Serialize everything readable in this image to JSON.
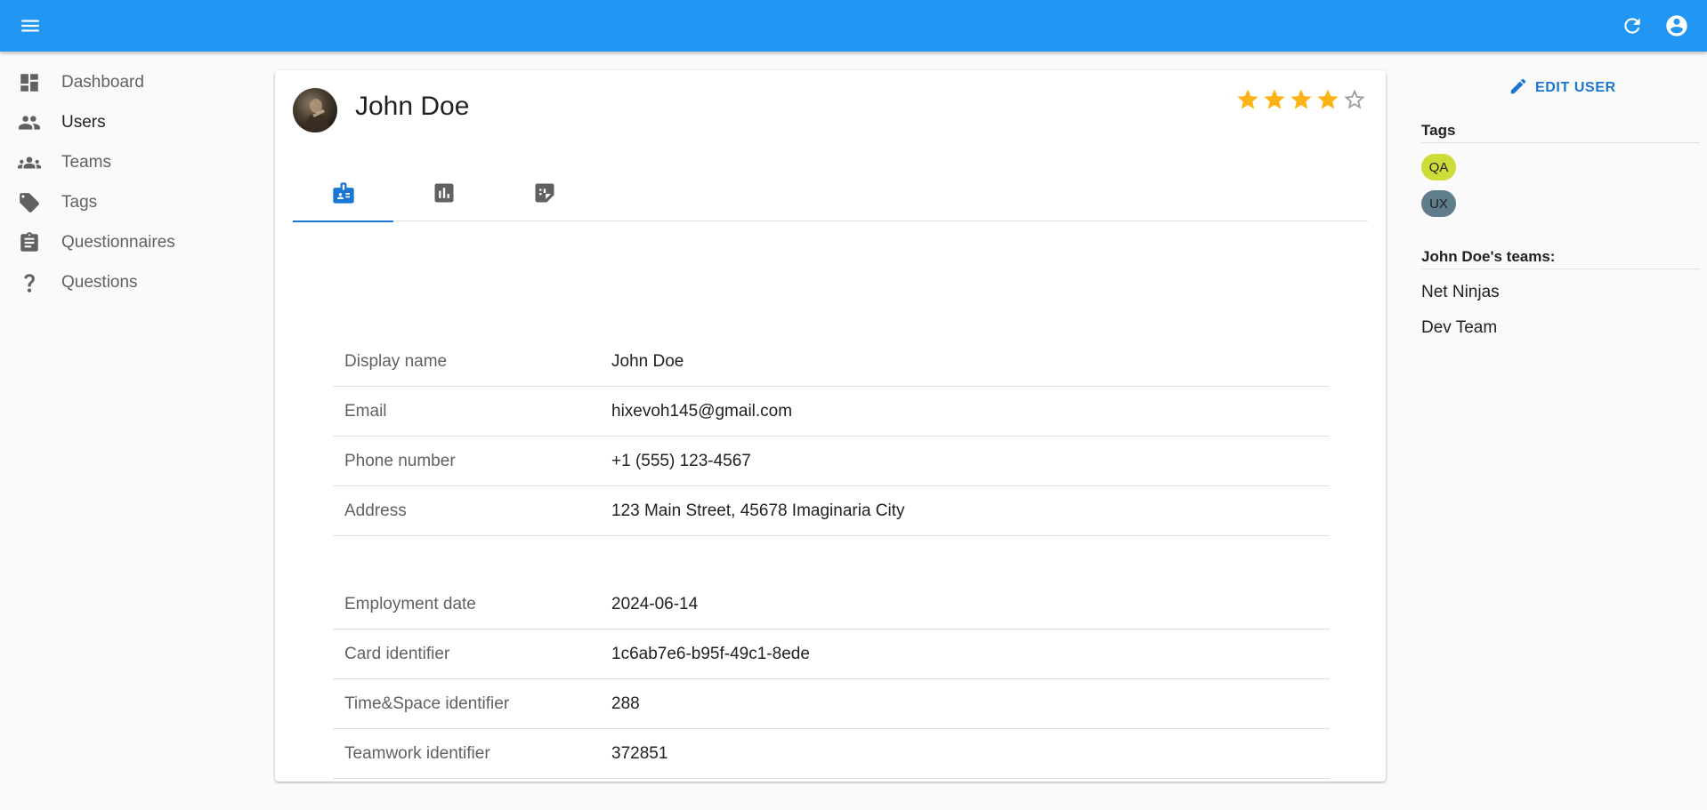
{
  "appbar": {
    "menu_icon": "menu-icon",
    "refresh_icon": "refresh-icon",
    "account_icon": "account-circle-icon",
    "color": "#2196f3"
  },
  "sidebar": {
    "items": [
      {
        "label": "Dashboard",
        "icon": "dashboard-icon"
      },
      {
        "label": "Users",
        "icon": "users-icon"
      },
      {
        "label": "Teams",
        "icon": "teams-icon"
      },
      {
        "label": "Tags",
        "icon": "tag-icon"
      },
      {
        "label": "Questionnaires",
        "icon": "clipboard-icon"
      },
      {
        "label": "Questions",
        "icon": "question-mark-icon"
      }
    ],
    "active": "Users"
  },
  "profile": {
    "name": "John Doe",
    "rating": 4,
    "rating_max": 5,
    "star_color": "#fbb316",
    "tabs": [
      {
        "icon": "contact-card-icon",
        "active": true
      },
      {
        "icon": "bar-chart-icon",
        "active": false
      },
      {
        "icon": "note-icon",
        "active": false
      }
    ],
    "details": [
      {
        "label": "Display name",
        "value": "John Doe"
      },
      {
        "label": "Email",
        "value": "hixevoh145@gmail.com"
      },
      {
        "label": "Phone number",
        "value": "+1 (555) 123-4567"
      },
      {
        "label": "Address",
        "value": "123 Main Street, 45678 Imaginaria City"
      }
    ],
    "employment": [
      {
        "label": "Employment date",
        "value": "2024-06-14"
      },
      {
        "label": "Card identifier",
        "value": "1c6ab7e6-b95f-49c1-8ede"
      },
      {
        "label": "Time&Space identifier",
        "value": "288"
      },
      {
        "label": "Teamwork identifier",
        "value": "372851"
      }
    ]
  },
  "right_panel": {
    "edit_label": "EDIT USER",
    "edit_icon": "pencil-icon",
    "accent": "#1976d2",
    "tags_title": "Tags",
    "tags": [
      {
        "label": "QA",
        "color": "#cddc39"
      },
      {
        "label": "UX",
        "color": "#607d8b"
      }
    ],
    "teams_title": "John Doe's teams:",
    "teams": [
      "Net Ninjas",
      "Dev Team"
    ]
  }
}
